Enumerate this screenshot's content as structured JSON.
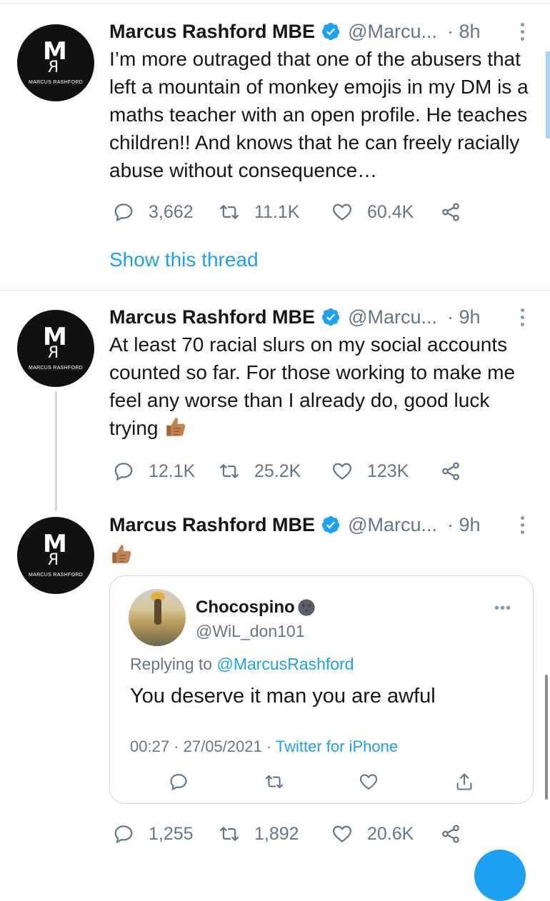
{
  "tweets": [
    {
      "author": {
        "name": "Marcus Rashford MBE",
        "handle": "@Marcu...",
        "avatar_label": "MARCUS RASHFORD"
      },
      "time": "· 8h",
      "text": "I’m more outraged that one of the abusers that left a mountain of monkey emojis in my DM is a maths teacher with an open profile. He teaches children!! And knows that he can freely racially abuse without consequence…",
      "replies": "3,662",
      "retweets": "11.1K",
      "likes": "60.4K",
      "show_thread": "Show this thread"
    },
    {
      "author": {
        "name": "Marcus Rashford MBE",
        "handle": "@Marcu...",
        "avatar_label": "MARCUS RASHFORD"
      },
      "time": "· 9h",
      "text": "At least 70 racial slurs on my social accounts counted so far. For those working to make me feel any worse than I already do, good luck trying",
      "emoji": "thumbs-up-medium-dark",
      "replies": "12.1K",
      "retweets": "25.2K",
      "likes": "123K"
    },
    {
      "author": {
        "name": "Marcus Rashford MBE",
        "handle": "@Marcu...",
        "avatar_label": "MARCUS RASHFORD"
      },
      "time": "· 9h",
      "emoji": "thumbs-up-medium-dark",
      "quote": {
        "name": "Chocospino",
        "name_emoji": "new-moon-face",
        "handle": "@WiL_don101",
        "replying_prefix": "Replying to",
        "replying_to": "@MarcusRashford",
        "text": "You deserve it man you are awful",
        "datetime": "00:27 · 27/05/2021 ·",
        "app": "Twitter for iPhone"
      },
      "replies": "1,255",
      "retweets": "1,892",
      "likes": "20.6K"
    }
  ],
  "colors": {
    "accent": "#1da1f2",
    "muted": "#657786",
    "text": "#14171a",
    "divider": "#e1e8ed",
    "avatar_bg": "#111111"
  },
  "icons": [
    "reply-icon",
    "retweet-icon",
    "like-icon",
    "share-icon",
    "verified-badge-icon",
    "more-icon"
  ]
}
